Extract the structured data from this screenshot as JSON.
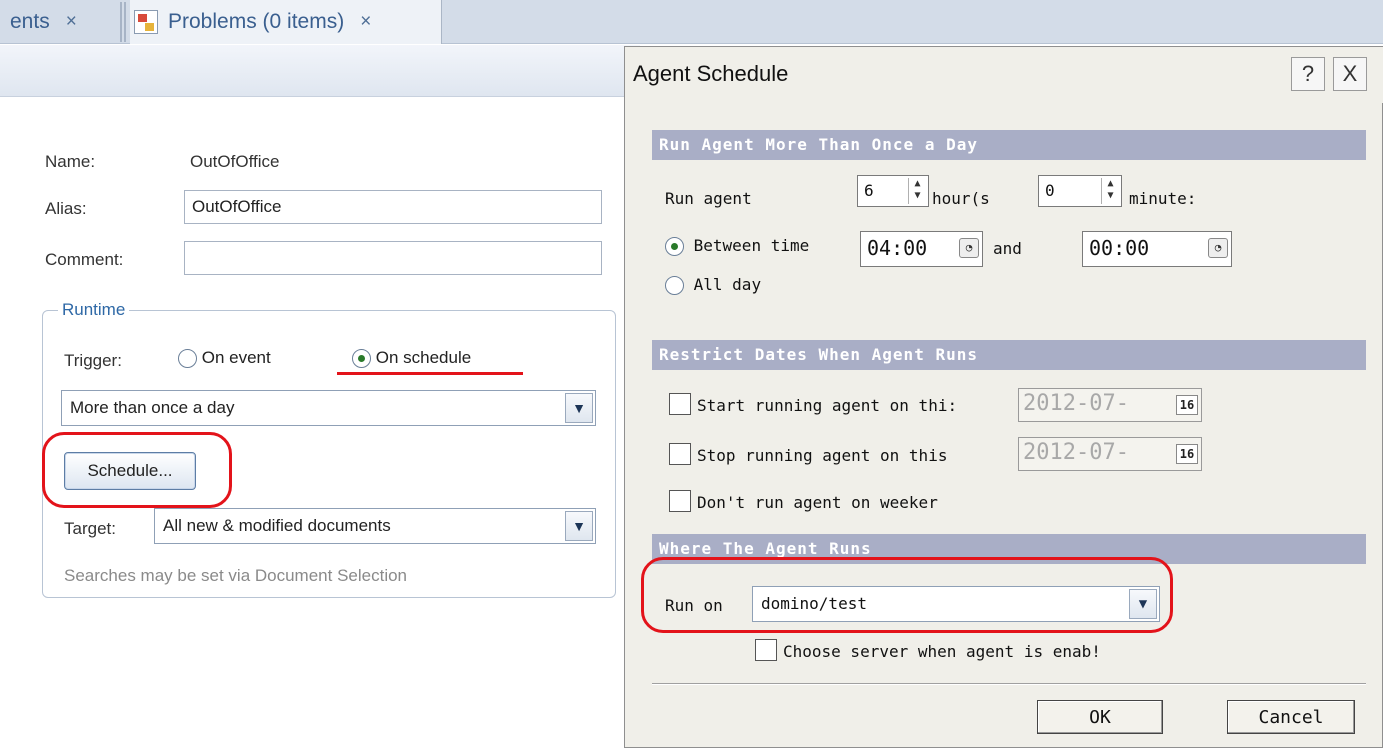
{
  "tabs": [
    {
      "label": "ents",
      "close": "×"
    },
    {
      "label": "Problems (0 items)",
      "close": "×"
    }
  ],
  "form": {
    "name_label": "Name:",
    "name_value": "OutOfOffice",
    "alias_label": "Alias:",
    "alias_value": "OutOfOffice",
    "comment_label": "Comment:",
    "comment_value": "",
    "runtime_legend": "Runtime",
    "trigger_label": "Trigger:",
    "trigger_on_event": "On event",
    "trigger_on_schedule": "On schedule",
    "trigger_selected": "On schedule",
    "frequency_value": "More than once a day",
    "schedule_button": "Schedule...",
    "target_label": "Target:",
    "target_value": "All new & modified documents",
    "hint": "Searches may be set via Document Selection"
  },
  "dialog": {
    "title": "Agent Schedule",
    "help_button": "?",
    "close_button": "X",
    "section1": "Run Agent More Than Once a Day",
    "run_agent_label": "Run agent",
    "hours_value": "6",
    "hours_label": "hour(s",
    "minutes_value": "0",
    "minutes_label": "minute:",
    "between_label": "Between time",
    "between_start": "04:00",
    "and_label": "and",
    "between_end": "00:00",
    "all_day_label": "All day",
    "time_mode_selected": "Between time",
    "section2": "Restrict Dates When Agent Runs",
    "start_label": "Start running agent on thi:",
    "start_date": "2012-07-",
    "start_checked": false,
    "stop_label": "Stop running agent on this",
    "stop_date": "2012-07-",
    "stop_checked": false,
    "weekend_label": "Don't run agent on weeker",
    "weekend_checked": false,
    "calendar_icon_text": "16",
    "section3": "Where The Agent Runs",
    "run_on_label": "Run on",
    "run_on_value": "domino/test",
    "choose_server_label": "Choose server when agent is enab!",
    "choose_server_checked": false,
    "ok_button": "OK",
    "cancel_button": "Cancel"
  },
  "colors": {
    "annotation": "#e3131a",
    "section_header": "#a9aec6",
    "dialog_bg": "#f0efe9",
    "tab_bar": "#d3dce8"
  }
}
